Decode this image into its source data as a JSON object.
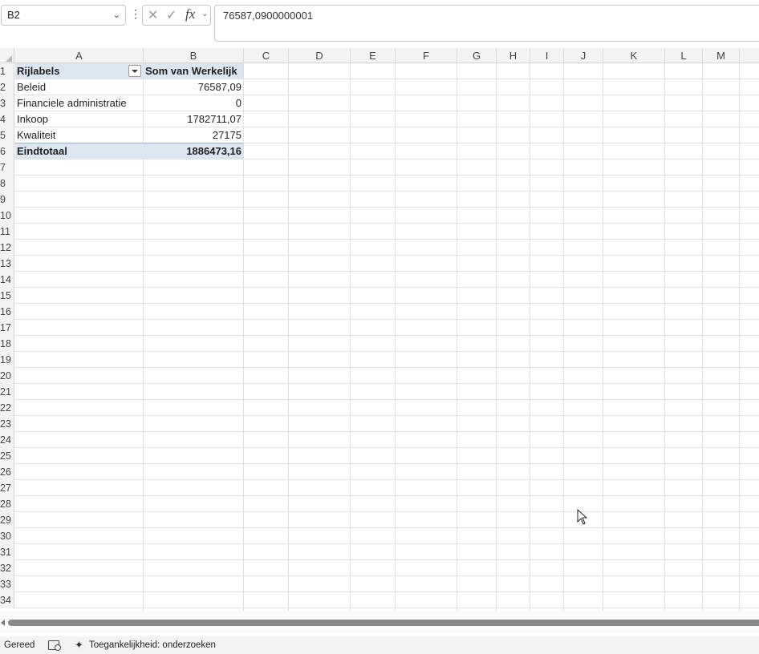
{
  "formula_bar": {
    "name_box": "B2",
    "formula": "76587,0900000001"
  },
  "columns": [
    "A",
    "B",
    "C",
    "D",
    "E",
    "F",
    "G",
    "H",
    "I",
    "J",
    "K",
    "L",
    "M"
  ],
  "rows": [
    "1",
    "2",
    "3",
    "4",
    "5",
    "6",
    "7",
    "8",
    "9",
    "10",
    "11",
    "12",
    "13",
    "14",
    "15",
    "16",
    "17",
    "18",
    "19",
    "20",
    "21",
    "22",
    "23",
    "24",
    "25",
    "26",
    "27",
    "28",
    "29",
    "30",
    "31",
    "32",
    "33",
    "34"
  ],
  "pivot": {
    "row_label_header": "Rijlabels",
    "value_header": "Som van Werkelijk",
    "items": [
      {
        "label": "Beleid",
        "value": "76587,09"
      },
      {
        "label": "Financiele administratie",
        "value": "0"
      },
      {
        "label": "Inkoop",
        "value": "1782711,07"
      },
      {
        "label": "Kwaliteit",
        "value": "27175"
      }
    ],
    "total_label": "Eindtotaal",
    "total_value": "1886473,16"
  },
  "status_bar": {
    "ready": "Gereed",
    "accessibility": "Toegankelijkheid: onderzoeken"
  },
  "colors": {
    "pivot_band": "#dce6f1",
    "header_bg": "#f3f3f3"
  }
}
